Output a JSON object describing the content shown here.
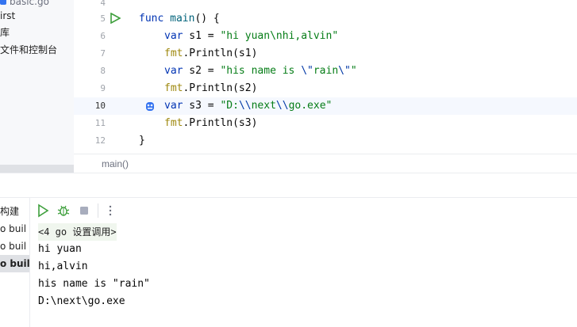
{
  "sidebar": {
    "items": [
      {
        "label": "basic.go"
      },
      {
        "label": "irst"
      },
      {
        "label": "库"
      },
      {
        "label": "文件和控制台"
      }
    ]
  },
  "editor": {
    "line_numbers": [
      "4",
      "5",
      "6",
      "7",
      "8",
      "9",
      "10",
      "11",
      "12"
    ],
    "active_line": "10",
    "lines": {
      "l5": {
        "kw": "func",
        "fn": "main",
        "rest": "() {"
      },
      "l6": {
        "kw": "var",
        "name": " s1 = ",
        "str": "\"hi yuan\\nhi,alvin\""
      },
      "l7": {
        "pkg": "fmt",
        "rest": ".Println(s1)"
      },
      "l8": {
        "kw": "var",
        "name": " s2 = ",
        "str_a": "\"his name is ",
        "esc_a": "\\\"",
        "str_b": "rain",
        "esc_b": "\\\"",
        "str_c": "\""
      },
      "l9": {
        "pkg": "fmt",
        "rest": ".Println(s2)"
      },
      "l10": {
        "kw": "var",
        "name": " s3 = ",
        "str_a": "\"D:",
        "esc_a": "\\\\",
        "str_b": "next",
        "esc_b": "\\\\",
        "str_c": "go.exe\""
      },
      "l11": {
        "pkg": "fmt",
        "rest": ".Println(s3)"
      },
      "l12": {
        "rest": "}"
      }
    },
    "breadcrumb": "main()"
  },
  "run": {
    "left_items": [
      {
        "label": "构建"
      },
      {
        "label": "o buil"
      },
      {
        "label": "o buil"
      },
      {
        "label": "o buil"
      }
    ],
    "command": "<4 go 设置调用>",
    "output": [
      "hi yuan",
      "hi,alvin",
      "his name is \"rain\"",
      "D:\\next\\go.exe"
    ]
  },
  "icons": {
    "run": "run-triangle-icon",
    "debug": "debug-bug-icon",
    "stop": "stop-square-icon",
    "more": "more-vertical-icon",
    "chevron": "chevron-right-icon"
  },
  "colors": {
    "keyword": "#0033b3",
    "string": "#067d17",
    "run_green": "#3e9f3c"
  }
}
